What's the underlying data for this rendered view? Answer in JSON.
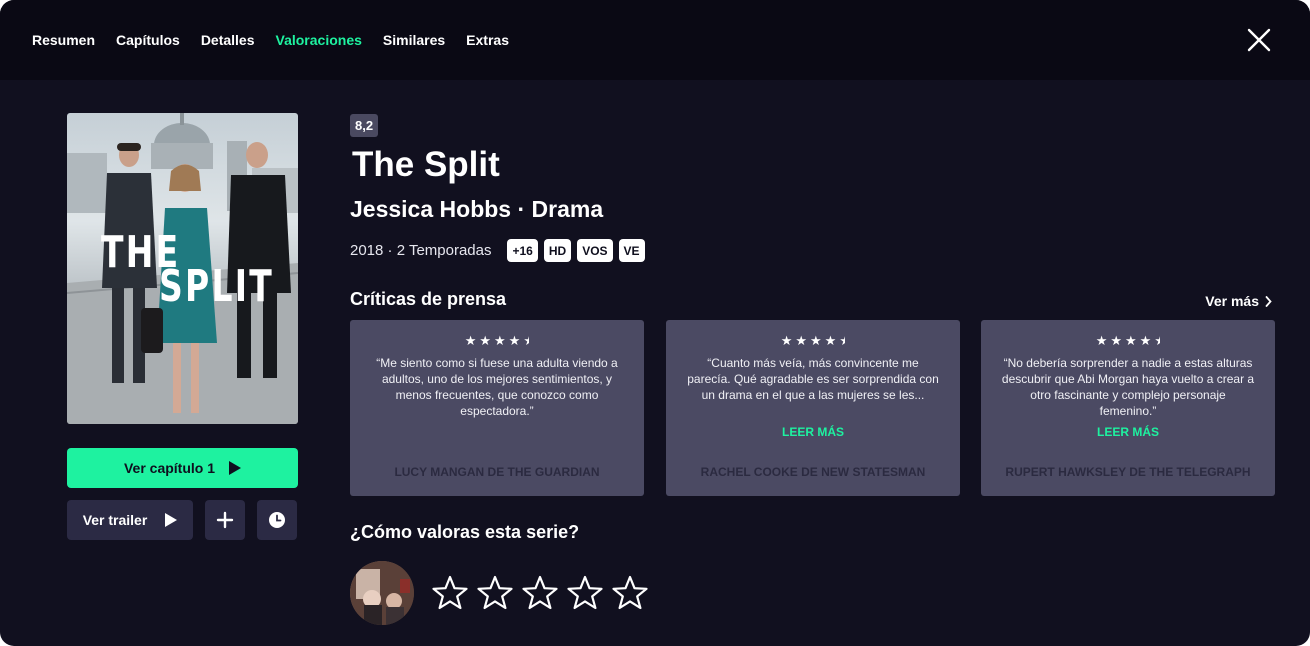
{
  "nav": {
    "tabs": [
      {
        "label": "Resumen",
        "active": false
      },
      {
        "label": "Capítulos",
        "active": false
      },
      {
        "label": "Detalles",
        "active": false
      },
      {
        "label": "Valoraciones",
        "active": true
      },
      {
        "label": "Similares",
        "active": false
      },
      {
        "label": "Extras",
        "active": false
      }
    ],
    "close_icon": "close-icon"
  },
  "poster": {
    "title_line1": "THE",
    "title_line2": "SPLIT"
  },
  "actions": {
    "play_label": "Ver capítulo 1",
    "trailer_label": "Ver trailer",
    "add_icon": "plus-icon",
    "later_icon": "clock-icon"
  },
  "show": {
    "score": "8,2",
    "title": "The Split",
    "subtitle": "Jessica Hobbs · Drama",
    "meta": "2018 · 2 Temporadas",
    "tags": [
      "+16",
      "HD",
      "VOS",
      "VE"
    ]
  },
  "press": {
    "section_title": "Críticas de prensa",
    "see_more": "Ver más",
    "reviews": [
      {
        "rating": 4.5,
        "quote": "“Me siento como si fuese una adulta viendo a adultos, uno de los mejores sentimientos, y menos frecuentes, que conozco como espectadora.”",
        "read_more": "",
        "author": "LUCY MANGAN DE THE GUARDIAN"
      },
      {
        "rating": 4.5,
        "quote": "“Cuanto más veía, más convincente me parecía. Qué agradable es ser sorprendida con un drama en el que a las mujeres se les...",
        "read_more": "LEER MÁS",
        "author": "RACHEL COOKE DE NEW STATESMAN"
      },
      {
        "rating": 4.5,
        "quote": "“No debería sorprender a nadie a estas alturas descubrir que Abi Morgan haya vuelto a crear a otro fascinante y complejo personaje femenino.”",
        "read_more": "LEER MÁS",
        "author": "RUPERT HAWKSLEY DE THE TELEGRAPH"
      }
    ]
  },
  "user_rating": {
    "section_title": "¿Cómo valoras esta serie?",
    "value": 0,
    "max": 5
  },
  "colors": {
    "accent": "#1ef2a0",
    "background": "#11101f",
    "card": "#4b4a63"
  }
}
